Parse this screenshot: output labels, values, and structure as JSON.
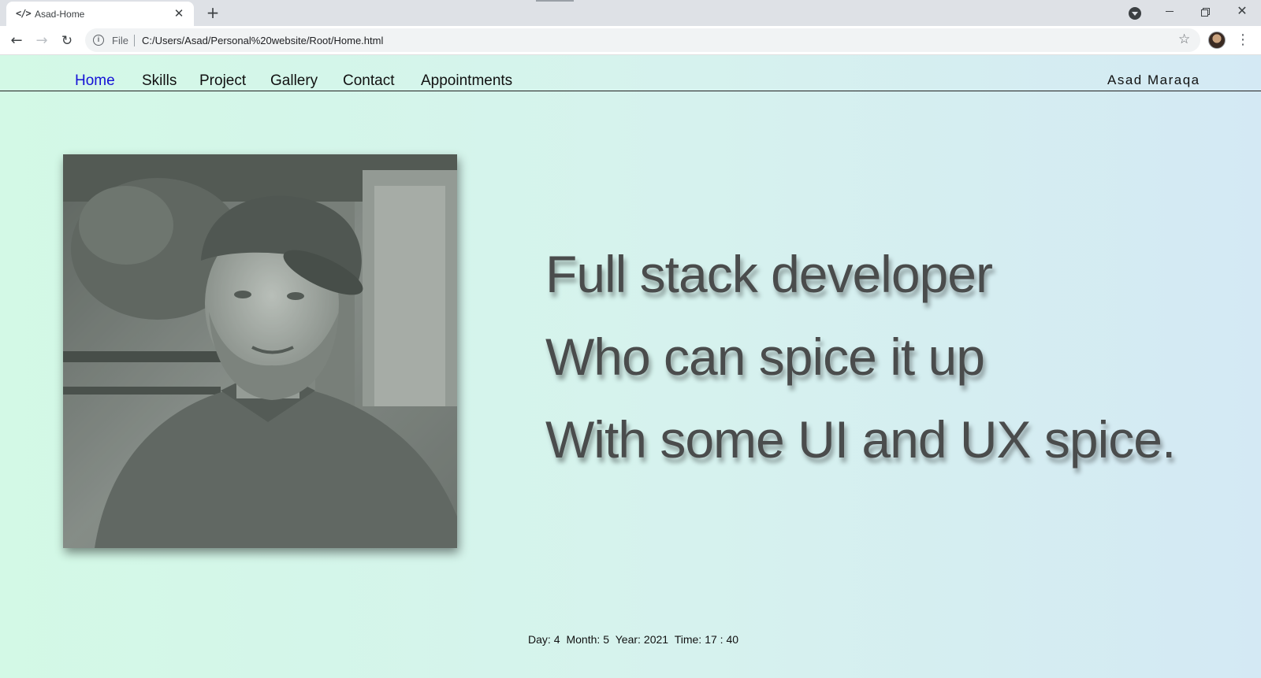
{
  "browser": {
    "tab_title": "Asad-Home",
    "tab_icon": "code-icon",
    "address_scheme": "File",
    "address_url": "C:/Users/Asad/Personal%20website/Root/Home.html"
  },
  "site": {
    "nav": {
      "items": [
        {
          "label": "Home",
          "active": true
        },
        {
          "label": "Skills",
          "active": false
        },
        {
          "label": "Project",
          "active": false
        },
        {
          "label": "Gallery",
          "active": false
        },
        {
          "label": "Contact",
          "active": false
        },
        {
          "label": "Appointments",
          "active": false
        }
      ],
      "active_color": "#1411d6"
    },
    "brand": "Asad Maraqa",
    "hero": {
      "line1": "Full stack developer",
      "line2": "Who can spice it up",
      "line3": "With some UI and UX spice."
    },
    "footer": {
      "day_label": "Day:",
      "day": "4",
      "month_label": "Month:",
      "month": "5",
      "year_label": "Year:",
      "year": "2021",
      "time_label": "Time:",
      "time": "17 : 40"
    },
    "colors": {
      "gradient_start": "#d3f9e6",
      "gradient_end": "#d4e9f4",
      "text": "#4a4c4c"
    }
  }
}
